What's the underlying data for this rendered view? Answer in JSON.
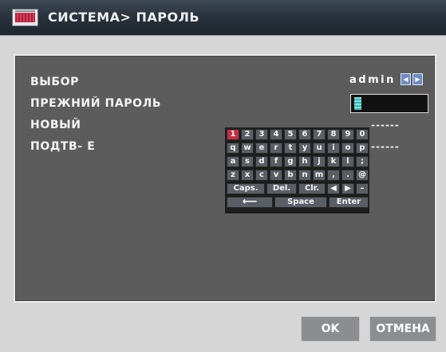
{
  "title": "СИСТЕМА> ПАРОЛЬ",
  "fields": {
    "select_label": "ВЫБОР",
    "old_password_label": "ПРЕЖНИЙ ПАРОЛЬ",
    "new_label": "НОВЫЙ",
    "confirm_label": "ПОДТВ- Е",
    "user_value": "admin",
    "new_dashes": "------",
    "confirm_dashes": "------"
  },
  "keyboard": {
    "row1": [
      "1",
      "2",
      "3",
      "4",
      "5",
      "6",
      "7",
      "8",
      "9",
      "0"
    ],
    "row2": [
      "q",
      "w",
      "e",
      "r",
      "t",
      "y",
      "u",
      "i",
      "o",
      "p"
    ],
    "row3": [
      "a",
      "s",
      "d",
      "f",
      "g",
      "h",
      "j",
      "k",
      "l",
      ";"
    ],
    "row4": [
      "z",
      "x",
      "c",
      "v",
      "b",
      "n",
      "m",
      ",",
      ".",
      "@"
    ],
    "row5": [
      "Caps.",
      "Del.",
      "Clr.",
      "◀",
      "▶",
      "–"
    ],
    "row6": [
      "⟵",
      "Space",
      "Enter"
    ],
    "selected_key": "1"
  },
  "buttons": {
    "ok": "OK",
    "cancel": "ОТМЕНА"
  },
  "icons": {
    "title_icon": "monitor-icon",
    "left_arrow": "left-arrow-icon",
    "right_arrow": "right-arrow-icon"
  },
  "colors": {
    "accent": "#6e8cc4",
    "selected_key": "#c23041",
    "cursor": "#3fb5b0"
  }
}
